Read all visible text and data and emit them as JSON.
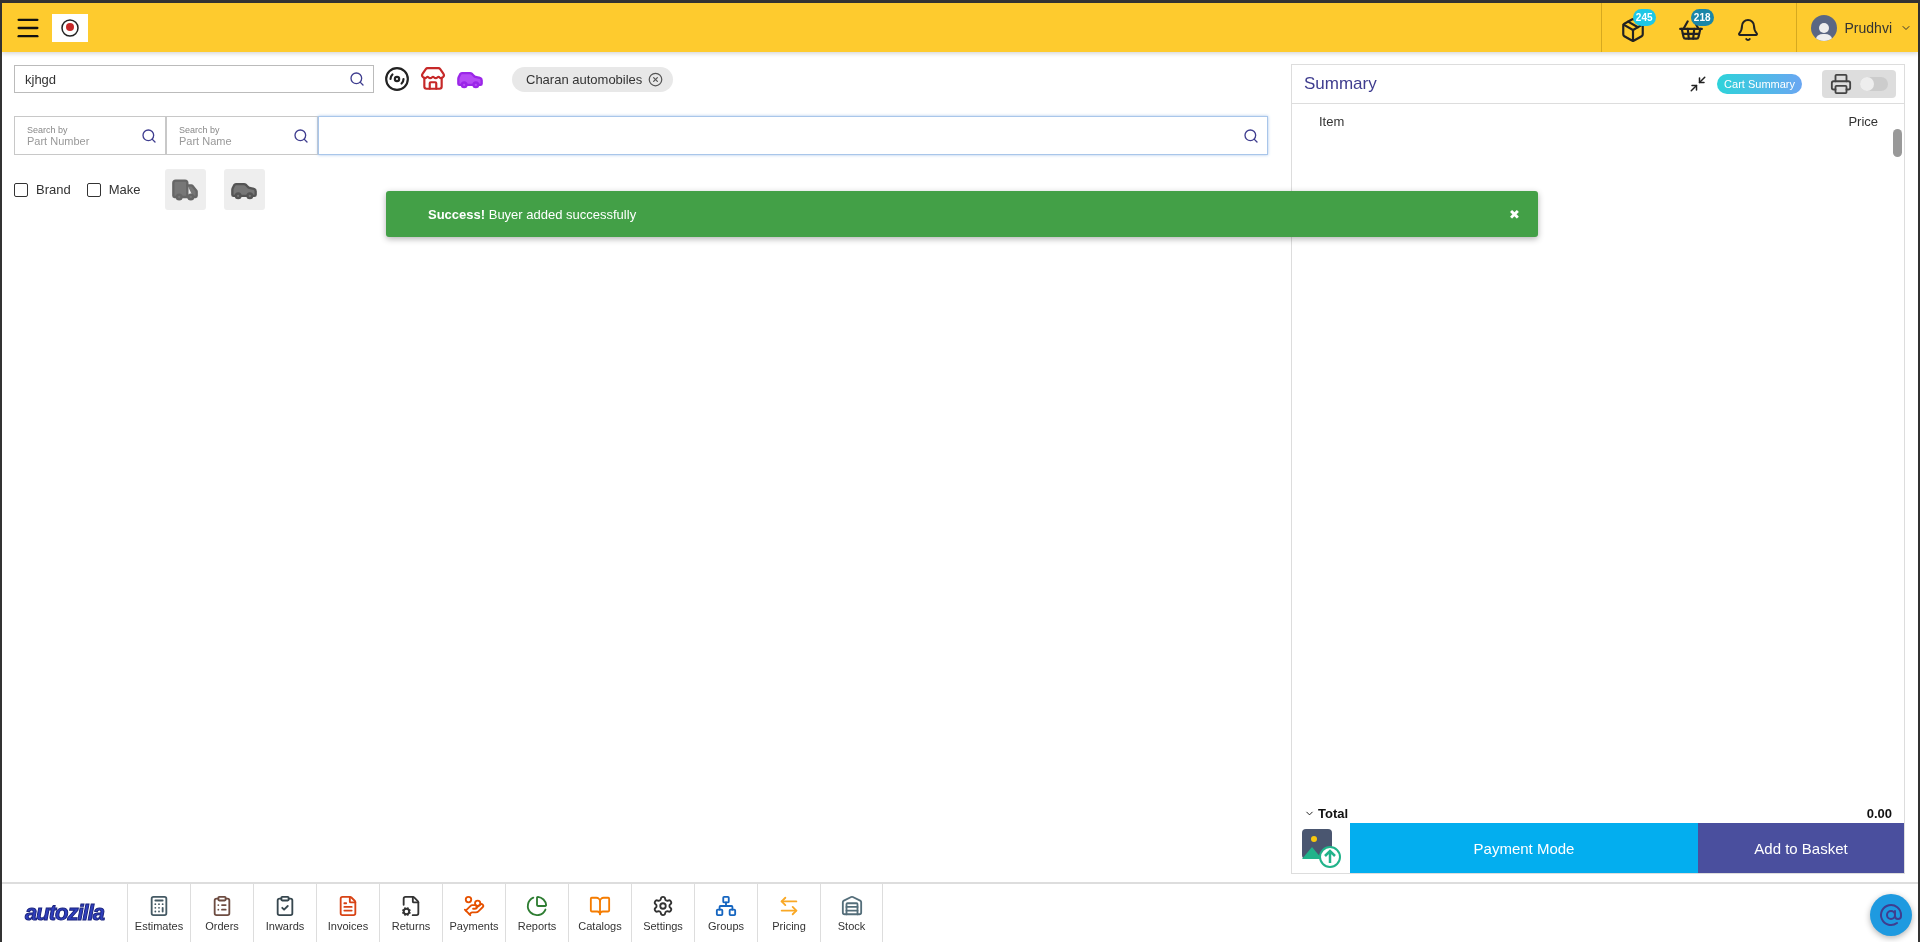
{
  "header": {
    "notifications": [
      {
        "kind": "box",
        "count": "245"
      },
      {
        "kind": "basket",
        "count": "218"
      },
      {
        "kind": "bell"
      }
    ],
    "user": {
      "name": "Prudhvi"
    }
  },
  "search": {
    "value": "kjhgd"
  },
  "customer_chip": {
    "label": "Charan automobiles"
  },
  "part_search": [
    {
      "label": "Search by",
      "placeholder": "Part Number"
    },
    {
      "label": "Search by",
      "placeholder": "Part Name"
    }
  ],
  "filters": [
    {
      "label": "Brand",
      "checked": false
    },
    {
      "label": "Make",
      "checked": false
    }
  ],
  "toast": {
    "title": "Success!",
    "message": "Buyer added successfully",
    "close": "✖"
  },
  "summary": {
    "title": "Summary",
    "badge": "Cart Summary",
    "print_toggle": {
      "on": false
    },
    "columns": [
      "Item",
      "Price"
    ],
    "total_label": "Total",
    "total": "0.00",
    "actions": [
      "Payment Mode",
      "Add to Basket"
    ]
  },
  "bottom_nav": {
    "logo": "autozilla",
    "items": [
      {
        "kind": "estimates",
        "label": "Estimates"
      },
      {
        "kind": "orders",
        "label": "Orders"
      },
      {
        "kind": "inwards",
        "label": "Inwards"
      },
      {
        "kind": "invoices",
        "label": "Invoices"
      },
      {
        "kind": "returns",
        "label": "Returns"
      },
      {
        "kind": "payments",
        "label": "Payments"
      },
      {
        "kind": "reports",
        "label": "Reports"
      },
      {
        "kind": "catalogs",
        "label": "Catalogs"
      },
      {
        "kind": "settings",
        "label": "Settings"
      },
      {
        "kind": "groups",
        "label": "Groups"
      },
      {
        "kind": "pricing",
        "label": "Pricing"
      },
      {
        "kind": "stock",
        "label": "Stock"
      }
    ]
  }
}
